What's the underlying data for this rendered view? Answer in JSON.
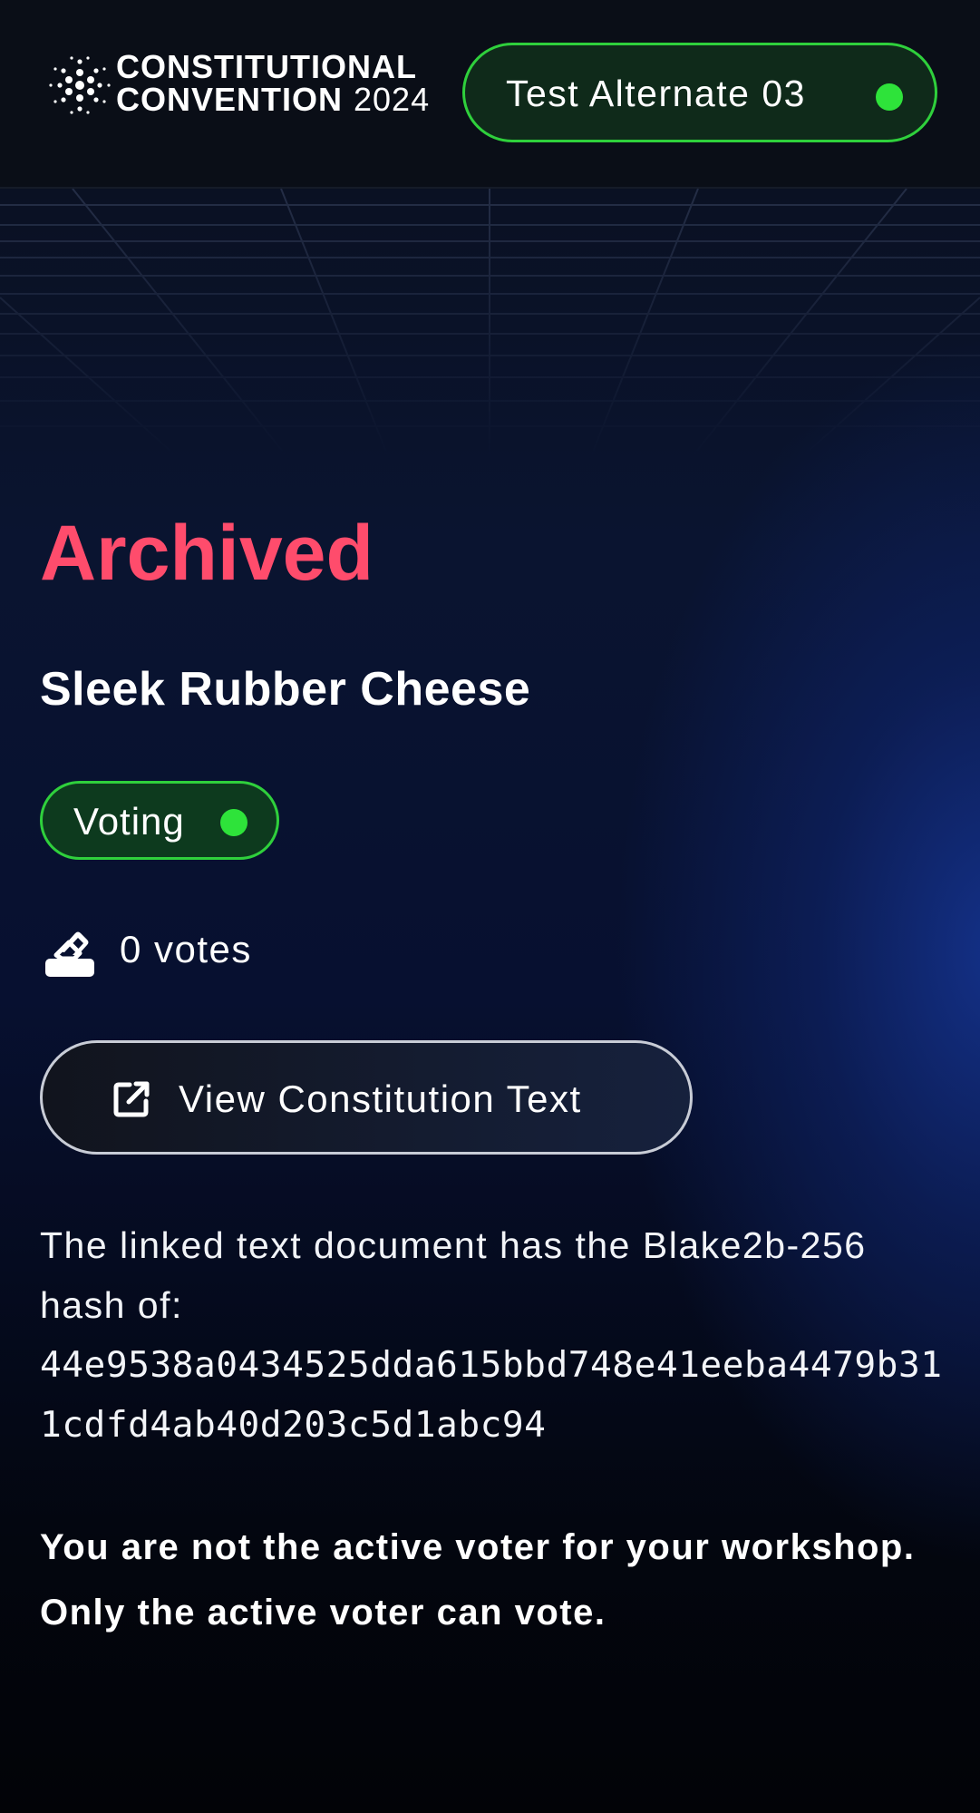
{
  "header": {
    "logo_line1": "CONSTITUTIONAL",
    "logo_line2": "CONVENTION",
    "logo_year": "2024",
    "user_label": "Test Alternate 03",
    "user_status_color": "#2ee33a"
  },
  "proposal": {
    "status": "Archived",
    "status_color": "#ff4c6c",
    "title": "Sleek Rubber Cheese",
    "phase_label": "Voting",
    "phase_status_color": "#2ee33a",
    "votes_text": "0 votes",
    "votes_icon": "ballot-icon",
    "view_button_label": "View Constitution Text",
    "view_button_icon": "external-link-icon",
    "hash_intro": "The linked text document has the Blake2b-256 hash of:",
    "hash_value": "44e9538a0434525dda615bbd748e41eeba4479b311cdfd4ab40d203c5d1abc94",
    "notice": "You are not the active voter for your workshop. Only the active voter can vote."
  }
}
